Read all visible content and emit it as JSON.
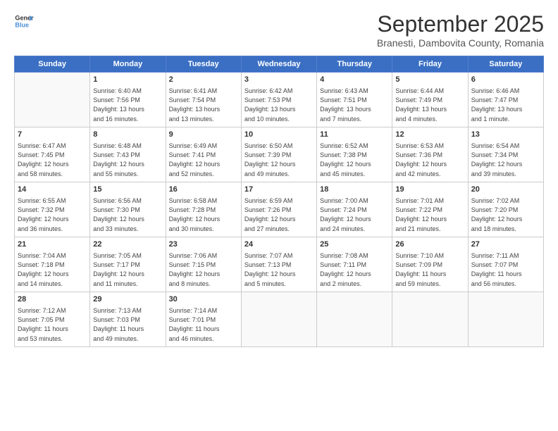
{
  "header": {
    "logo_line1": "General",
    "logo_line2": "Blue",
    "month": "September 2025",
    "location": "Branesti, Dambovita County, Romania"
  },
  "weekdays": [
    "Sunday",
    "Monday",
    "Tuesday",
    "Wednesday",
    "Thursday",
    "Friday",
    "Saturday"
  ],
  "weeks": [
    [
      {
        "day": "",
        "info": ""
      },
      {
        "day": "1",
        "info": "Sunrise: 6:40 AM\nSunset: 7:56 PM\nDaylight: 13 hours\nand 16 minutes."
      },
      {
        "day": "2",
        "info": "Sunrise: 6:41 AM\nSunset: 7:54 PM\nDaylight: 13 hours\nand 13 minutes."
      },
      {
        "day": "3",
        "info": "Sunrise: 6:42 AM\nSunset: 7:53 PM\nDaylight: 13 hours\nand 10 minutes."
      },
      {
        "day": "4",
        "info": "Sunrise: 6:43 AM\nSunset: 7:51 PM\nDaylight: 13 hours\nand 7 minutes."
      },
      {
        "day": "5",
        "info": "Sunrise: 6:44 AM\nSunset: 7:49 PM\nDaylight: 13 hours\nand 4 minutes."
      },
      {
        "day": "6",
        "info": "Sunrise: 6:46 AM\nSunset: 7:47 PM\nDaylight: 13 hours\nand 1 minute."
      }
    ],
    [
      {
        "day": "7",
        "info": "Sunrise: 6:47 AM\nSunset: 7:45 PM\nDaylight: 12 hours\nand 58 minutes."
      },
      {
        "day": "8",
        "info": "Sunrise: 6:48 AM\nSunset: 7:43 PM\nDaylight: 12 hours\nand 55 minutes."
      },
      {
        "day": "9",
        "info": "Sunrise: 6:49 AM\nSunset: 7:41 PM\nDaylight: 12 hours\nand 52 minutes."
      },
      {
        "day": "10",
        "info": "Sunrise: 6:50 AM\nSunset: 7:39 PM\nDaylight: 12 hours\nand 49 minutes."
      },
      {
        "day": "11",
        "info": "Sunrise: 6:52 AM\nSunset: 7:38 PM\nDaylight: 12 hours\nand 45 minutes."
      },
      {
        "day": "12",
        "info": "Sunrise: 6:53 AM\nSunset: 7:36 PM\nDaylight: 12 hours\nand 42 minutes."
      },
      {
        "day": "13",
        "info": "Sunrise: 6:54 AM\nSunset: 7:34 PM\nDaylight: 12 hours\nand 39 minutes."
      }
    ],
    [
      {
        "day": "14",
        "info": "Sunrise: 6:55 AM\nSunset: 7:32 PM\nDaylight: 12 hours\nand 36 minutes."
      },
      {
        "day": "15",
        "info": "Sunrise: 6:56 AM\nSunset: 7:30 PM\nDaylight: 12 hours\nand 33 minutes."
      },
      {
        "day": "16",
        "info": "Sunrise: 6:58 AM\nSunset: 7:28 PM\nDaylight: 12 hours\nand 30 minutes."
      },
      {
        "day": "17",
        "info": "Sunrise: 6:59 AM\nSunset: 7:26 PM\nDaylight: 12 hours\nand 27 minutes."
      },
      {
        "day": "18",
        "info": "Sunrise: 7:00 AM\nSunset: 7:24 PM\nDaylight: 12 hours\nand 24 minutes."
      },
      {
        "day": "19",
        "info": "Sunrise: 7:01 AM\nSunset: 7:22 PM\nDaylight: 12 hours\nand 21 minutes."
      },
      {
        "day": "20",
        "info": "Sunrise: 7:02 AM\nSunset: 7:20 PM\nDaylight: 12 hours\nand 18 minutes."
      }
    ],
    [
      {
        "day": "21",
        "info": "Sunrise: 7:04 AM\nSunset: 7:18 PM\nDaylight: 12 hours\nand 14 minutes."
      },
      {
        "day": "22",
        "info": "Sunrise: 7:05 AM\nSunset: 7:17 PM\nDaylight: 12 hours\nand 11 minutes."
      },
      {
        "day": "23",
        "info": "Sunrise: 7:06 AM\nSunset: 7:15 PM\nDaylight: 12 hours\nand 8 minutes."
      },
      {
        "day": "24",
        "info": "Sunrise: 7:07 AM\nSunset: 7:13 PM\nDaylight: 12 hours\nand 5 minutes."
      },
      {
        "day": "25",
        "info": "Sunrise: 7:08 AM\nSunset: 7:11 PM\nDaylight: 12 hours\nand 2 minutes."
      },
      {
        "day": "26",
        "info": "Sunrise: 7:10 AM\nSunset: 7:09 PM\nDaylight: 11 hours\nand 59 minutes."
      },
      {
        "day": "27",
        "info": "Sunrise: 7:11 AM\nSunset: 7:07 PM\nDaylight: 11 hours\nand 56 minutes."
      }
    ],
    [
      {
        "day": "28",
        "info": "Sunrise: 7:12 AM\nSunset: 7:05 PM\nDaylight: 11 hours\nand 53 minutes."
      },
      {
        "day": "29",
        "info": "Sunrise: 7:13 AM\nSunset: 7:03 PM\nDaylight: 11 hours\nand 49 minutes."
      },
      {
        "day": "30",
        "info": "Sunrise: 7:14 AM\nSunset: 7:01 PM\nDaylight: 11 hours\nand 46 minutes."
      },
      {
        "day": "",
        "info": ""
      },
      {
        "day": "",
        "info": ""
      },
      {
        "day": "",
        "info": ""
      },
      {
        "day": "",
        "info": ""
      }
    ]
  ]
}
